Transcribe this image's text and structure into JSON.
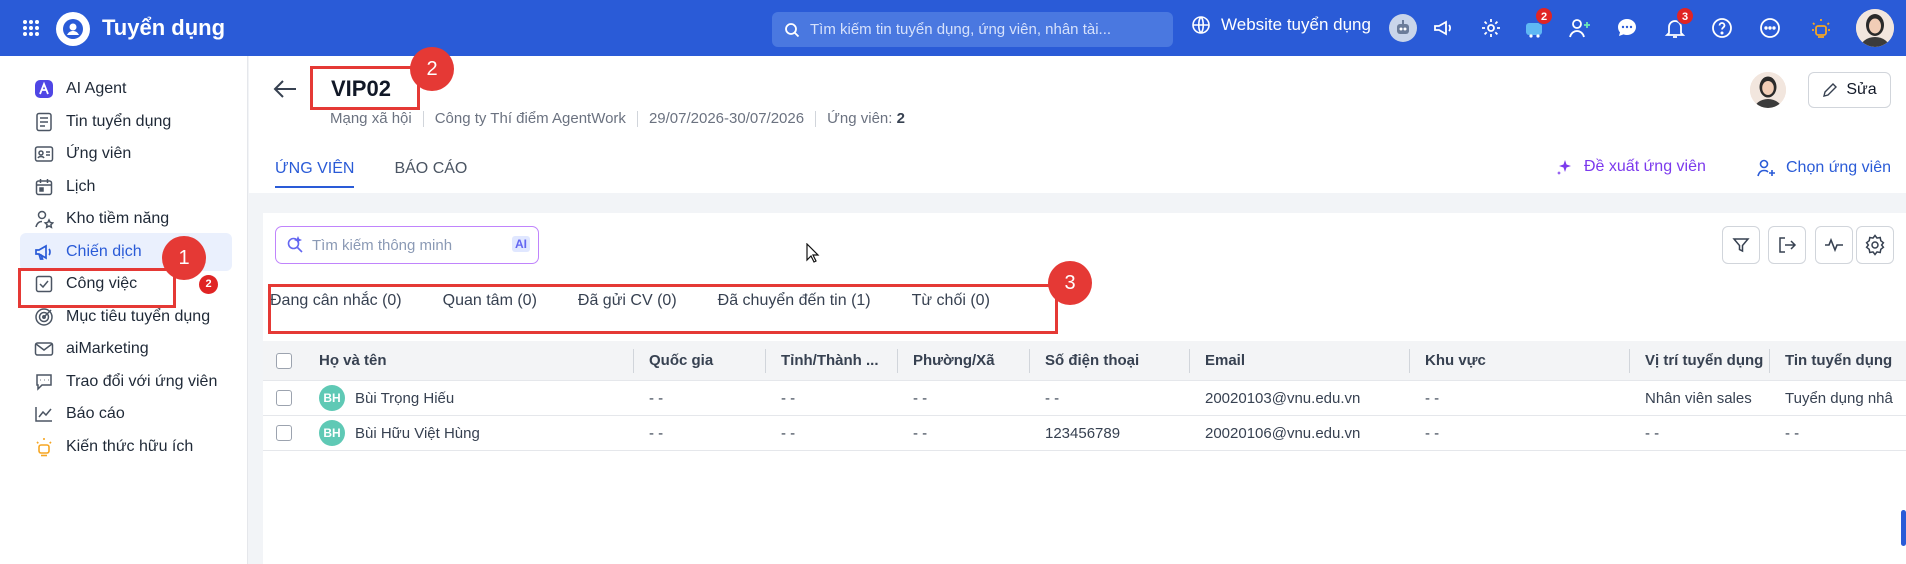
{
  "topbar": {
    "app_title": "Tuyển dụng",
    "search_placeholder": "Tìm kiếm tin tuyển dụng, ứng viên, nhân tài...",
    "website_label": "Website tuyển dụng",
    "cart_badge": "2",
    "notification_badge": "3",
    "colors": {
      "bar": "#2a5bd7",
      "badge": "#e02424"
    }
  },
  "sidebar": {
    "items": [
      {
        "label": "AI Agent",
        "icon": "ai-agent-icon"
      },
      {
        "label": "Tin tuyển dụng",
        "icon": "document-icon"
      },
      {
        "label": "Ứng viên",
        "icon": "id-card-icon"
      },
      {
        "label": "Lịch",
        "icon": "calendar-icon"
      },
      {
        "label": "Kho tiềm năng",
        "icon": "talent-pool-icon"
      },
      {
        "label": "Chiến dịch",
        "icon": "megaphone-icon",
        "active": true
      },
      {
        "label": "Công việc",
        "icon": "task-icon",
        "badge": "2"
      },
      {
        "label": "Mục tiêu tuyển dụng",
        "icon": "target-icon"
      },
      {
        "label": "aiMarketing",
        "icon": "mail-icon"
      },
      {
        "label": "Trao đổi với ứng viên",
        "icon": "chat-icon"
      },
      {
        "label": "Báo cáo",
        "icon": "chart-icon"
      },
      {
        "label": "Kiến thức hữu ích",
        "icon": "lightbulb-icon"
      }
    ]
  },
  "campaign": {
    "title": "VIP02",
    "meta": {
      "channel": "Mạng xã hội",
      "company": "Công ty Thí điểm AgentWork",
      "date_range": "29/07/2026-30/07/2026",
      "candidates_label": "Ứng viên:",
      "candidates_count": "2"
    },
    "edit_label": "Sửa"
  },
  "tabs": [
    {
      "label": "ỨNG VIÊN",
      "active": true
    },
    {
      "label": "BÁO CÁO",
      "active": false
    }
  ],
  "actions": {
    "suggest": "Đề xuất ứng viên",
    "pick": "Chọn ứng viên"
  },
  "smart_search": {
    "placeholder": "Tìm kiếm thông minh",
    "ai_tag": "AI"
  },
  "statuses": [
    "Đang cân nhắc (0)",
    "Quan tâm (0)",
    "Đã gửi CV (0)",
    "Đã chuyển đến tin (1)",
    "Từ chối (0)"
  ],
  "table": {
    "columns": [
      "Họ và tên",
      "Quốc gia",
      "Tỉnh/Thành ...",
      "Phường/Xã",
      "Số điện thoại",
      "Email",
      "Khu vực",
      "Vị trí tuyển dụng",
      "Tin tuyển dụng"
    ],
    "rows": [
      {
        "initials": "BH",
        "cells": [
          "Bùi Trọng Hiếu",
          "- -",
          "- -",
          "- -",
          "- -",
          "20020103@vnu.edu.vn",
          "- -",
          "Nhân viên sales",
          "Tuyển dụng nhâ"
        ]
      },
      {
        "initials": "BH",
        "cells": [
          "Bùi Hữu Việt Hùng",
          "- -",
          "- -",
          "- -",
          "123456789",
          "20020106@vnu.edu.vn",
          "- -",
          "- -",
          "- -"
        ]
      }
    ]
  },
  "annotations": {
    "one": "1",
    "two": "2",
    "three": "3",
    "color": "#e53935"
  }
}
